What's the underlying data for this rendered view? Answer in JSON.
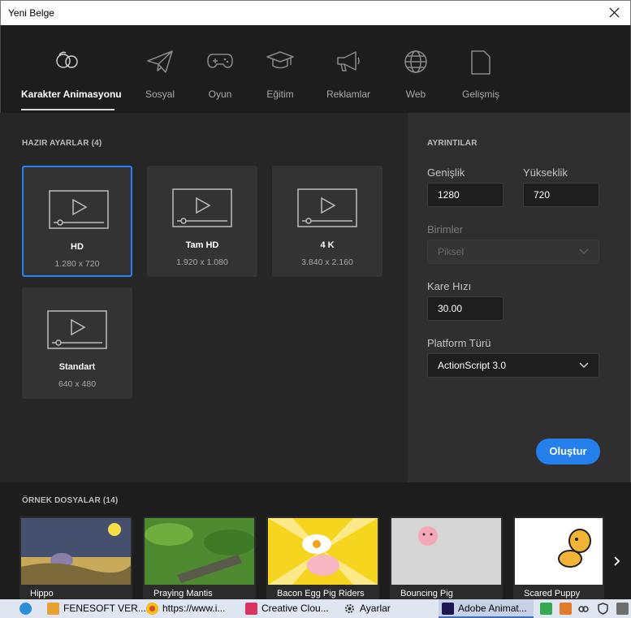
{
  "window": {
    "title": "Yeni Belge",
    "close_icon": "close-icon"
  },
  "tabs": [
    {
      "label": "Karakter Animasyonu",
      "icon": "character-animation-icon",
      "active": true
    },
    {
      "label": "Sosyal",
      "icon": "paper-plane-icon",
      "active": false
    },
    {
      "label": "Oyun",
      "icon": "gamepad-icon",
      "active": false
    },
    {
      "label": "Eğitim",
      "icon": "graduation-cap-icon",
      "active": false
    },
    {
      "label": "Reklamlar",
      "icon": "megaphone-icon",
      "active": false
    },
    {
      "label": "Web",
      "icon": "globe-icon",
      "active": false
    },
    {
      "label": "Gelişmiş",
      "icon": "document-icon",
      "active": false
    }
  ],
  "presets": {
    "title": "HAZIR AYARLAR (4)",
    "items": [
      {
        "name": "HD",
        "size": "1.280 x 720",
        "selected": true
      },
      {
        "name": "Tam HD",
        "size": "1.920 x 1.080",
        "selected": false
      },
      {
        "name": "4 K",
        "size": "3.840 x 2.160",
        "selected": false
      },
      {
        "name": "Standart",
        "size": "640 x 480",
        "selected": false
      }
    ]
  },
  "details": {
    "title": "AYRINTILAR",
    "width_label": "Genişlik",
    "width_value": "1280",
    "height_label": "Yükseklik",
    "height_value": "720",
    "units_label": "Birimler",
    "units_value": "Piksel",
    "fps_label": "Kare Hızı",
    "fps_value": "30.00",
    "platform_label": "Platform Türü",
    "platform_value": "ActionScript 3.0",
    "create_label": "Oluştur"
  },
  "samples": {
    "title": "ÖRNEK DOSYALAR (14)",
    "items": [
      {
        "name": "Hippo"
      },
      {
        "name": "Praying Mantis"
      },
      {
        "name": "Bacon Egg Pig Riders"
      },
      {
        "name": "Bouncing Pig"
      },
      {
        "name": "Scared Puppy"
      }
    ]
  },
  "taskbar": {
    "items": [
      {
        "label": "FENESOFT VER..."
      },
      {
        "label": "https://www.i..."
      },
      {
        "label": "Creative Clou..."
      },
      {
        "label": "Ayarlar"
      },
      {
        "label": "Adobe Animat..."
      }
    ]
  },
  "colors": {
    "accent": "#2680eb",
    "selected_border": "#2d7ff9",
    "background": "#1d1d1d",
    "panel": "#262626",
    "details_panel": "#2f2f2f"
  }
}
